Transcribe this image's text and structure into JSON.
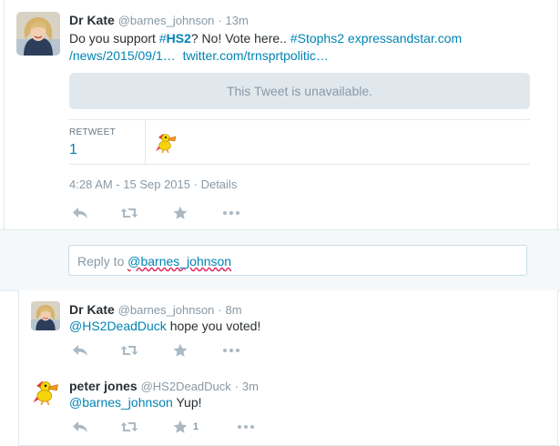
{
  "main_tweet": {
    "author_name": "Dr Kate",
    "handle": "@barnes_johnson",
    "separator": "·",
    "time": "13m",
    "text_prefix": "Do you support ",
    "hashtag_hs2_hash": "#",
    "hashtag_hs2_word": "HS2",
    "text_middle": "? No! Vote here.. ",
    "hashtag_stophs2": "#Stophs2",
    "link_express_part1": "expressandstar.com",
    "link_express_part2": "/news/2015/09/1…",
    "link_twitter": "twitter.com/trnsprtpolitic…",
    "quoted_unavailable": "This Tweet is unavailable.",
    "retweet_label": "RETWEET",
    "retweet_count": "1",
    "timestamp": "4:28 AM - 15 Sep 2015",
    "meta_separator": "·",
    "details_link": "Details",
    "actions": {
      "reply": "reply-icon",
      "retweet": "retweet-icon",
      "favorite": "star-icon",
      "more": "more-icon"
    }
  },
  "reply_box": {
    "prefix": "Reply to ",
    "mention": "@barnes_johnson"
  },
  "replies": [
    {
      "author_name": "Dr Kate",
      "handle": "@barnes_johnson",
      "separator": "·",
      "time": "8m",
      "mention": "@HS2DeadDuck",
      "text": " hope you voted!",
      "favorite_count": ""
    },
    {
      "author_name": "peter jones",
      "handle": "@HS2DeadDuck",
      "separator": "·",
      "time": "3m",
      "mention": "@barnes_johnson",
      "text": " Yup!",
      "favorite_count": "1"
    }
  ],
  "colors": {
    "link": "#0084b4",
    "muted": "#8899a6",
    "text": "#292f33",
    "border": "#e1e8ed",
    "reply_bg": "#f5f8fa"
  }
}
